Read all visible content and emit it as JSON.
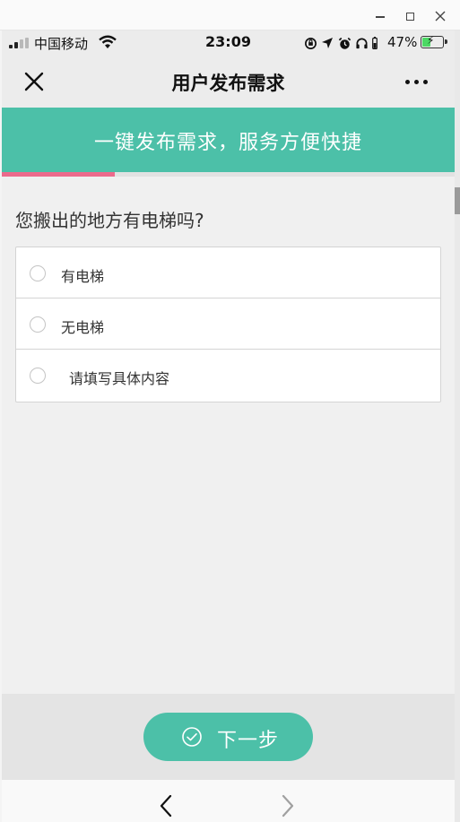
{
  "window": {
    "minimize_icon": "minimize-icon",
    "maximize_icon": "maximize-icon",
    "close_glyph": "×"
  },
  "status_bar": {
    "carrier": "中国移动",
    "time": "23:09",
    "battery_percent": "47%",
    "battery_level": 0.47,
    "battery_color": "#4cd964",
    "icons": [
      "orientation-lock-icon",
      "location-arrow-icon",
      "alarm-icon",
      "headphones-icon",
      "battery-small-icon"
    ]
  },
  "nav": {
    "close_icon": "close-icon",
    "title": "用户发布需求",
    "more_icon": "more-dots-icon"
  },
  "banner": {
    "text": "一键发布需求，服务方便快捷",
    "color": "#4cc0a8"
  },
  "progress": {
    "fraction": 0.25,
    "color": "#ec6a8c"
  },
  "question": {
    "text": "您搬出的地方有电梯吗?",
    "options": [
      {
        "label": "有电梯"
      },
      {
        "label": "无电梯"
      },
      {
        "label": "请填写具体内容"
      }
    ]
  },
  "footer": {
    "next_label": "下一步",
    "next_icon": "check-circle-icon"
  },
  "bottom_nav": {
    "back_icon": "back-arrow-icon",
    "forward_icon": "forward-arrow-icon"
  }
}
